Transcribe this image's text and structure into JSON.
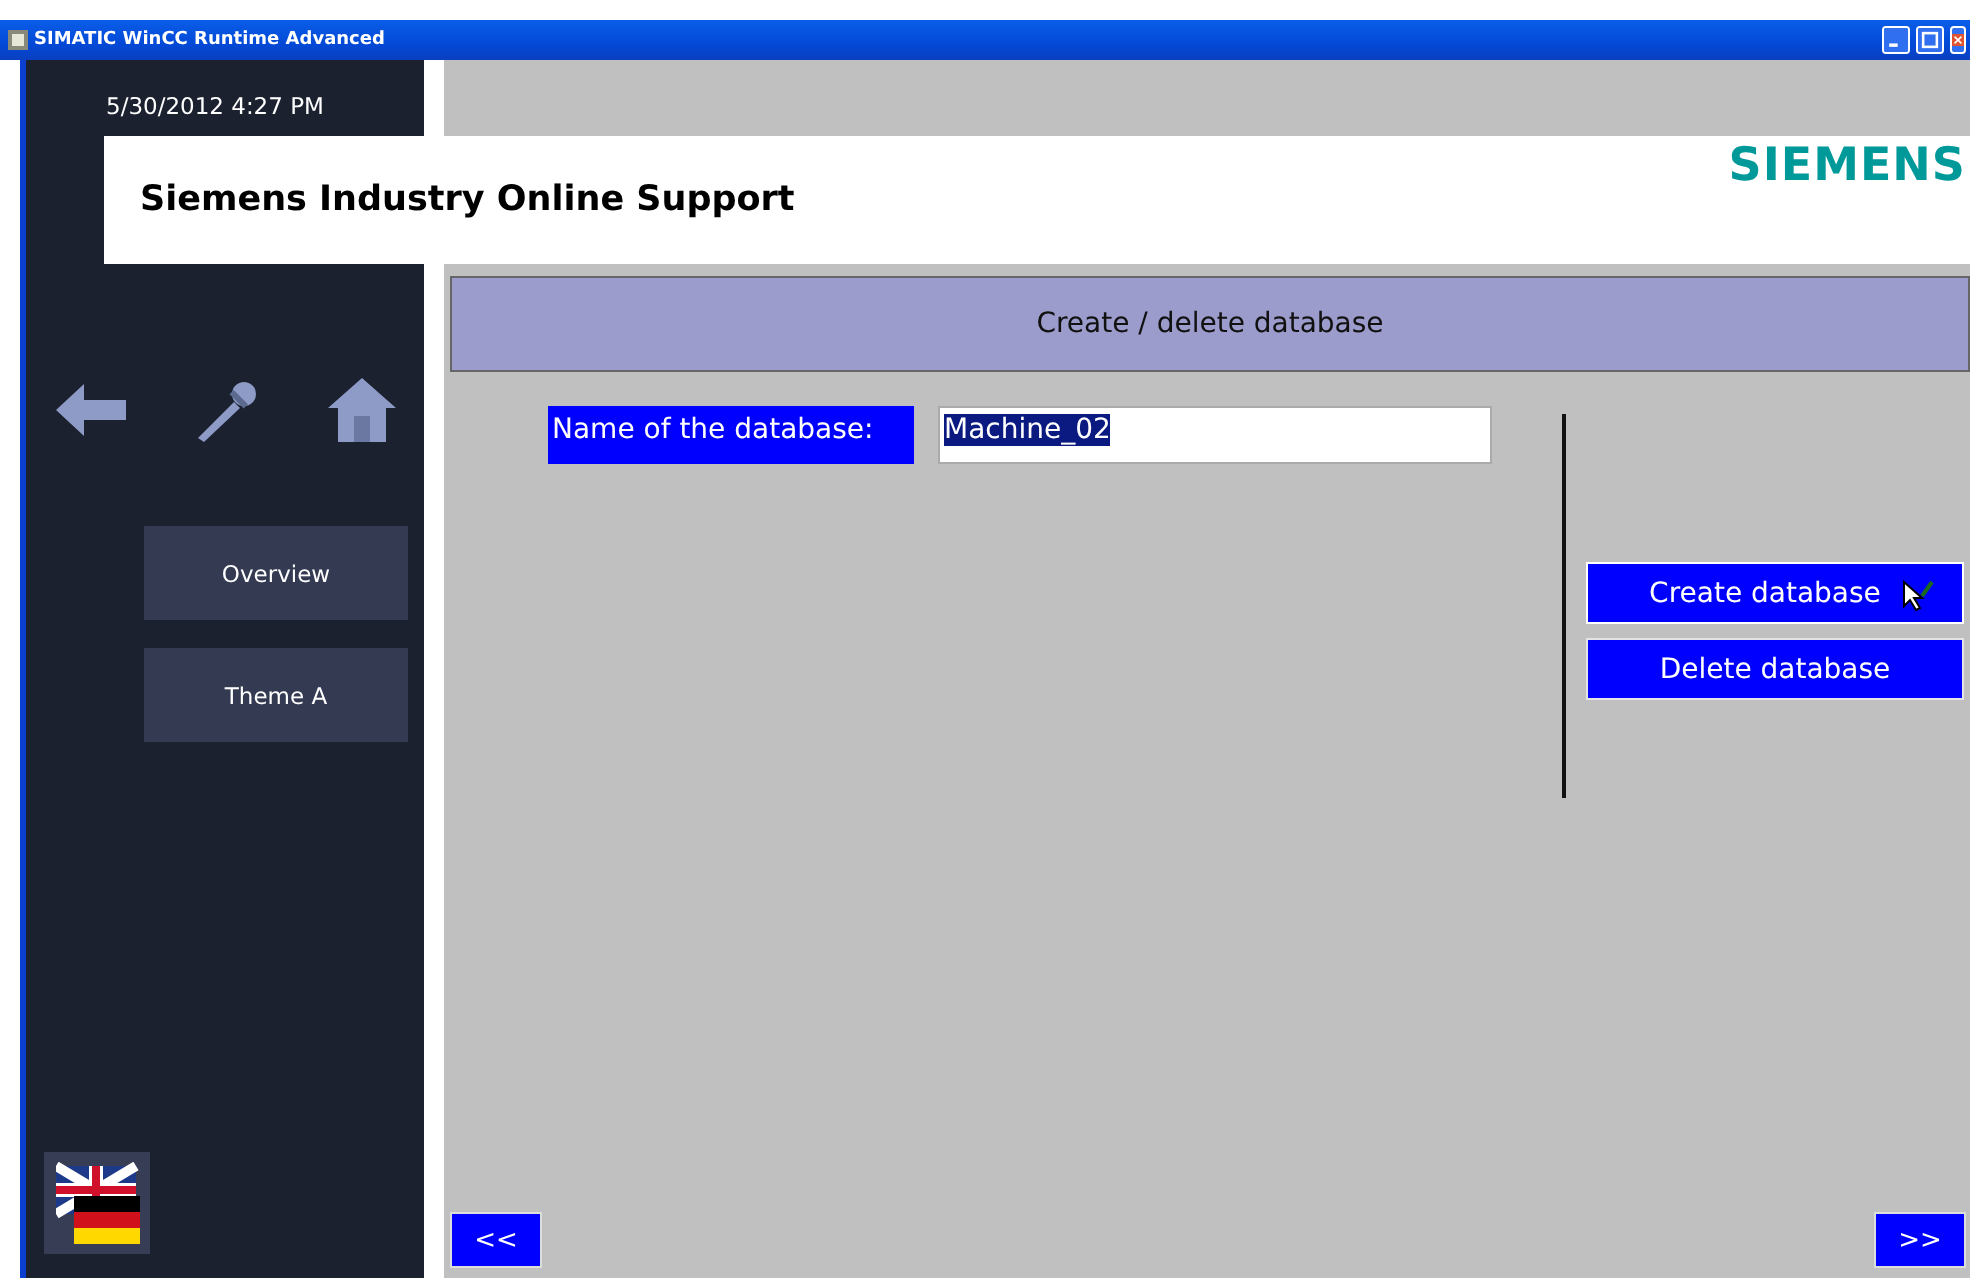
{
  "window": {
    "title": "SIMATIC WinCC Runtime Advanced"
  },
  "sidebar": {
    "datetime": "5/30/2012 4:27 PM",
    "menu": [
      {
        "label": "Overview"
      },
      {
        "label": "Theme A"
      }
    ]
  },
  "header": {
    "title": "Siemens Industry Online Support",
    "logo": "SIEMENS"
  },
  "screen": {
    "heading": "Create / delete database",
    "field": {
      "label": "Name of the database:",
      "value": "Machine_02",
      "text_selected": true
    },
    "buttons": [
      {
        "label": "Create database",
        "hovered": true
      },
      {
        "label": "Delete database",
        "hovered": false
      }
    ]
  },
  "nav": {
    "previous": "<<",
    "next": ">>"
  }
}
